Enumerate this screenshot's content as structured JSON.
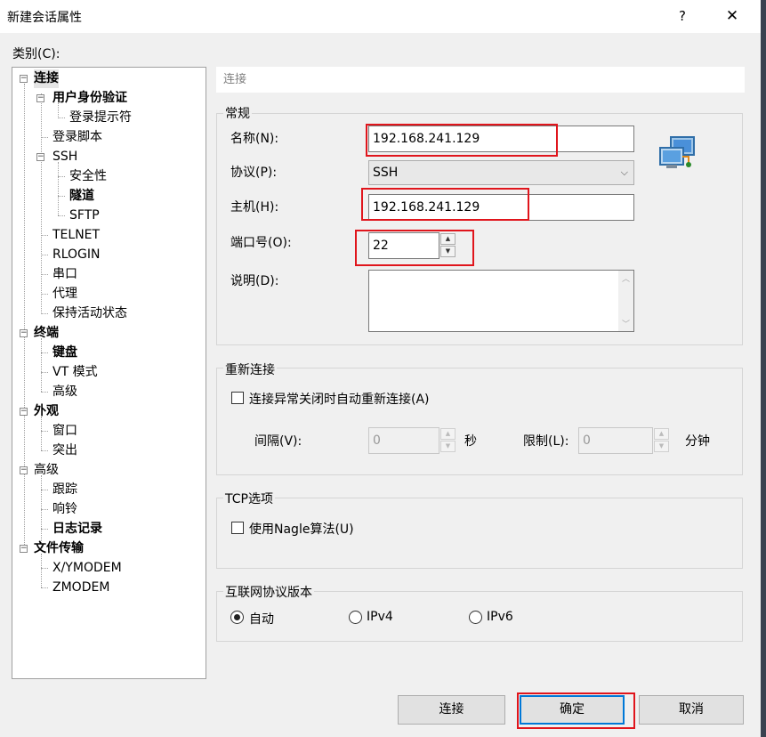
{
  "window": {
    "title": "新建会话属性",
    "help": "?",
    "close": "✕"
  },
  "category_label": "类别(C):",
  "tree": {
    "items": [
      "连接",
      "用户身份验证",
      "登录提示符",
      "登录脚本",
      "SSH",
      "安全性",
      "隧道",
      "SFTP",
      "TELNET",
      "RLOGIN",
      "串口",
      "代理",
      "保持活动状态",
      "终端",
      "键盘",
      "VT 模式",
      "高级",
      "外观",
      "窗口",
      "突出",
      "高级",
      "跟踪",
      "响铃",
      "日志记录",
      "文件传输",
      "X/YMODEM",
      "ZMODEM"
    ],
    "expander_minus": "−"
  },
  "section_title": "连接",
  "general": {
    "title": "常规",
    "name_label": "名称(N):",
    "name_value": "192.168.241.129",
    "protocol_label": "协议(P):",
    "protocol_value": "SSH",
    "host_label": "主机(H):",
    "host_value": "192.168.241.129",
    "port_label": "端口号(O):",
    "port_value": "22",
    "desc_label": "说明(D):",
    "desc_value": ""
  },
  "reconnect": {
    "title": "重新连接",
    "auto_label": "连接异常关闭时自动重新连接(A)",
    "auto_checked": false,
    "interval_label": "间隔(V):",
    "interval_value": "0",
    "interval_unit": "秒",
    "limit_label": "限制(L):",
    "limit_value": "0",
    "limit_unit": "分钟"
  },
  "tcp": {
    "title": "TCP选项",
    "nagle_label": "使用Nagle算法(U)",
    "nagle_checked": false
  },
  "ip": {
    "title": "互联网协议版本",
    "options": [
      "自动",
      "IPv4",
      "IPv6"
    ],
    "selected": "自动"
  },
  "buttons": {
    "connect": "连接",
    "ok": "确定",
    "cancel": "取消"
  },
  "icons": {
    "spin_up": "▲",
    "spin_down": "▼",
    "select_arrow": "⌵",
    "scroll_up": "︿",
    "scroll_down": "﹀"
  },
  "colors": {
    "highlight": "#e0151c",
    "focus": "#0078d7"
  }
}
